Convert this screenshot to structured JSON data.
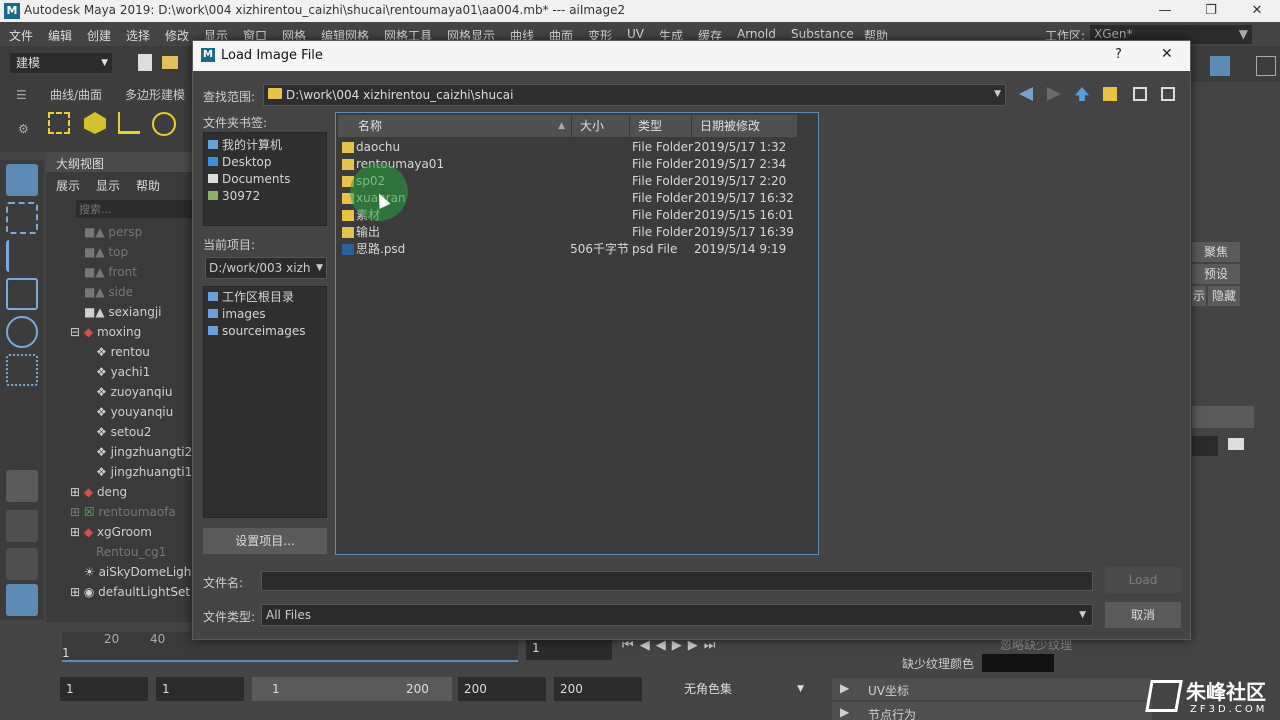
{
  "window": {
    "title": "Autodesk Maya 2019: D:\\work\\004 xizhirentou_caizhi\\shucai\\rentoumaya01\\aa004.mb*   ---   aiImage2",
    "logo": "M"
  },
  "menubar": {
    "items": [
      "文件",
      "编辑",
      "创建",
      "选择",
      "修改",
      "显示",
      "窗口",
      "网格",
      "编辑网格",
      "网格工具",
      "网格显示",
      "曲线",
      "曲面",
      "变形",
      "UV",
      "生成",
      "缓存",
      "Arnold",
      "Substance",
      "帮助"
    ],
    "workspace_label": "工作区:",
    "workspace_value": "XGen*"
  },
  "shelf": {
    "mode": "建模",
    "tabs": [
      "曲线/曲面",
      "多边形建模"
    ]
  },
  "outliner": {
    "title": "大纲视图",
    "menus": [
      "展示",
      "显示",
      "帮助"
    ],
    "search_placeholder": "搜索...",
    "rows": [
      {
        "label": "persp",
        "dim": true
      },
      {
        "label": "top",
        "dim": true
      },
      {
        "label": "front",
        "dim": true
      },
      {
        "label": "side",
        "dim": true
      },
      {
        "label": "sexiangji",
        "dim": false
      },
      {
        "label": "moxing",
        "dim": false
      },
      {
        "label": "rentou",
        "dim": false
      },
      {
        "label": "yachi1",
        "dim": false
      },
      {
        "label": "zuoyanqiu",
        "dim": false
      },
      {
        "label": "youyanqiu",
        "dim": false
      },
      {
        "label": "setou2",
        "dim": false
      },
      {
        "label": "jingzhuangti2",
        "dim": false
      },
      {
        "label": "jingzhuangti1",
        "dim": false
      },
      {
        "label": "deng",
        "dim": false
      },
      {
        "label": "rentoumaofa",
        "dim": true
      },
      {
        "label": "xgGroom",
        "dim": false
      },
      {
        "label": "Rentou_cg1",
        "dim": true
      },
      {
        "label": "aiSkyDomeLight",
        "dim": false
      },
      {
        "label": "defaultLightSet",
        "dim": false
      }
    ]
  },
  "rightpanel": {
    "focus": "聚焦",
    "preset": "预设",
    "show": "示",
    "hide": "隐藏"
  },
  "bottom": {
    "ticks": [
      "20",
      "40"
    ],
    "frame_left": "1",
    "start": "1",
    "range_start": "1",
    "range_inner_start": "1",
    "range_inner_end": "200",
    "range_end": "200",
    "end": "200",
    "current_frame": "1",
    "color_set": "无角色集",
    "missing_texture": "缺少纹理颜色",
    "ignore_texture": "忽略缺少纹理",
    "uv_coords": "UV坐标",
    "node_behavior": "节点行为"
  },
  "dialog": {
    "title": "Load Image File",
    "help": "?",
    "close": "✕",
    "lookin_label": "查找范围:",
    "lookin_path": "D:\\work\\004 xizhirentou_caizhi\\shucai",
    "bookmarks_label": "文件夹书签:",
    "bookmarks": [
      {
        "label": "我的计算机",
        "color": "#6aa0d8"
      },
      {
        "label": "Desktop",
        "color": "#3b8ee0"
      },
      {
        "label": "Documents",
        "color": "#dddddd"
      },
      {
        "label": "30972",
        "color": "#8fb06a"
      }
    ],
    "current_project_label": "当前项目:",
    "current_project": "D:/work/003 xizh",
    "project_folders": [
      "工作区根目录",
      "images",
      "sourceimages"
    ],
    "set_project_button": "设置项目...",
    "columns": [
      "名称",
      "大小",
      "类型",
      "日期被修改"
    ],
    "files": [
      {
        "name": "daochu",
        "size": "",
        "type": "File Folder",
        "date": "2019/5/17 1:32",
        "icon": "folder"
      },
      {
        "name": "rentoumaya01",
        "size": "",
        "type": "File Folder",
        "date": "2019/5/17 2:34",
        "icon": "folder"
      },
      {
        "name": "sp02",
        "size": "",
        "type": "File Folder",
        "date": "2019/5/17 2:20",
        "icon": "folder"
      },
      {
        "name": "xuanran",
        "size": "",
        "type": "File Folder",
        "date": "2019/5/17 16:32",
        "icon": "folder"
      },
      {
        "name": "素材",
        "size": "",
        "type": "File Folder",
        "date": "2019/5/15 16:01",
        "icon": "folder"
      },
      {
        "name": "输出",
        "size": "",
        "type": "File Folder",
        "date": "2019/5/17 16:39",
        "icon": "folder"
      },
      {
        "name": "思路.psd",
        "size": "506千字节",
        "type": "psd File",
        "date": "2019/5/14 9:19",
        "icon": "psd"
      }
    ],
    "filename_label": "文件名:",
    "filename_value": "",
    "load_button": "Load",
    "filetype_label": "文件类型:",
    "filetype_value": "All Files",
    "cancel_button": "取消"
  },
  "watermark": {
    "line1": "朱峰社区",
    "line2": "ZF3D.COM"
  },
  "colors": {
    "folder": "#e8c34a",
    "accent": "#5d8bb5",
    "dialog_bg": "#444444",
    "list_bg": "#3b3b3b"
  }
}
